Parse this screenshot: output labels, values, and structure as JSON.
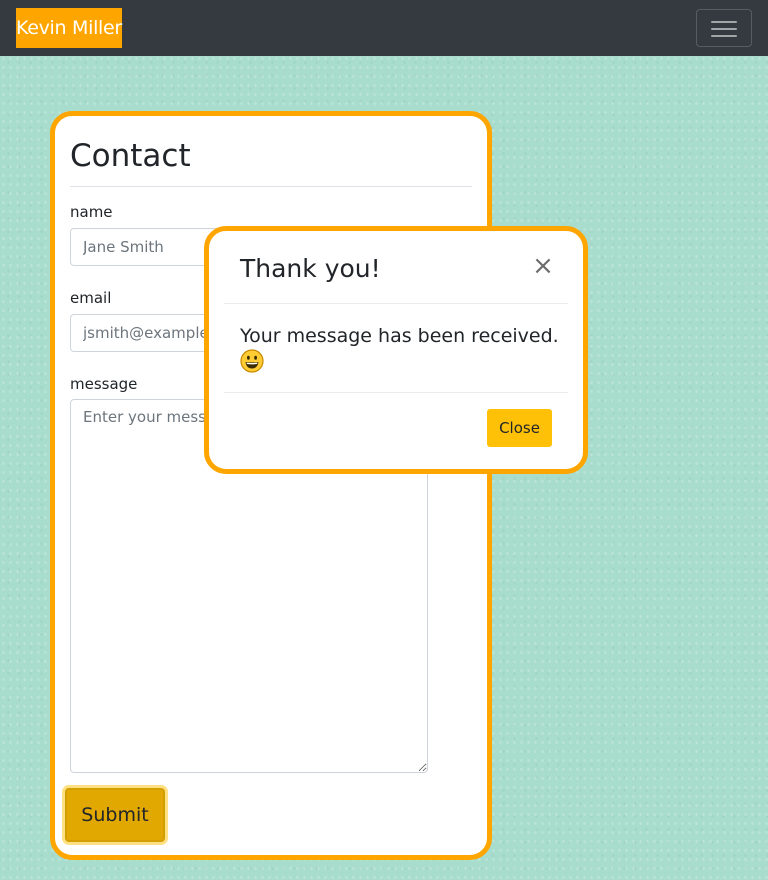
{
  "navbar": {
    "brand": "Kevin Miller",
    "toggler_icon": "hamburger-menu-icon"
  },
  "contact": {
    "title": "Contact",
    "name": {
      "label": "name",
      "placeholder": "Jane Smith",
      "value": ""
    },
    "email": {
      "label": "email",
      "placeholder": "jsmith@example.com",
      "value": ""
    },
    "message": {
      "label": "message",
      "placeholder": "Enter your message",
      "value": ""
    },
    "submit_label": "Submit"
  },
  "modal": {
    "title": "Thank you!",
    "close_icon": "close-icon",
    "close_glyph": "×",
    "body_text": "Your message has been received.",
    "body_emoji": "grinning-face-emoji",
    "close_button_label": "Close"
  },
  "colors": {
    "accent": "#ffa500",
    "navbar_bg": "#343a40",
    "page_bg": "#a8dccd",
    "submit_bg": "#e0a800",
    "close_button_bg": "#ffc107"
  }
}
